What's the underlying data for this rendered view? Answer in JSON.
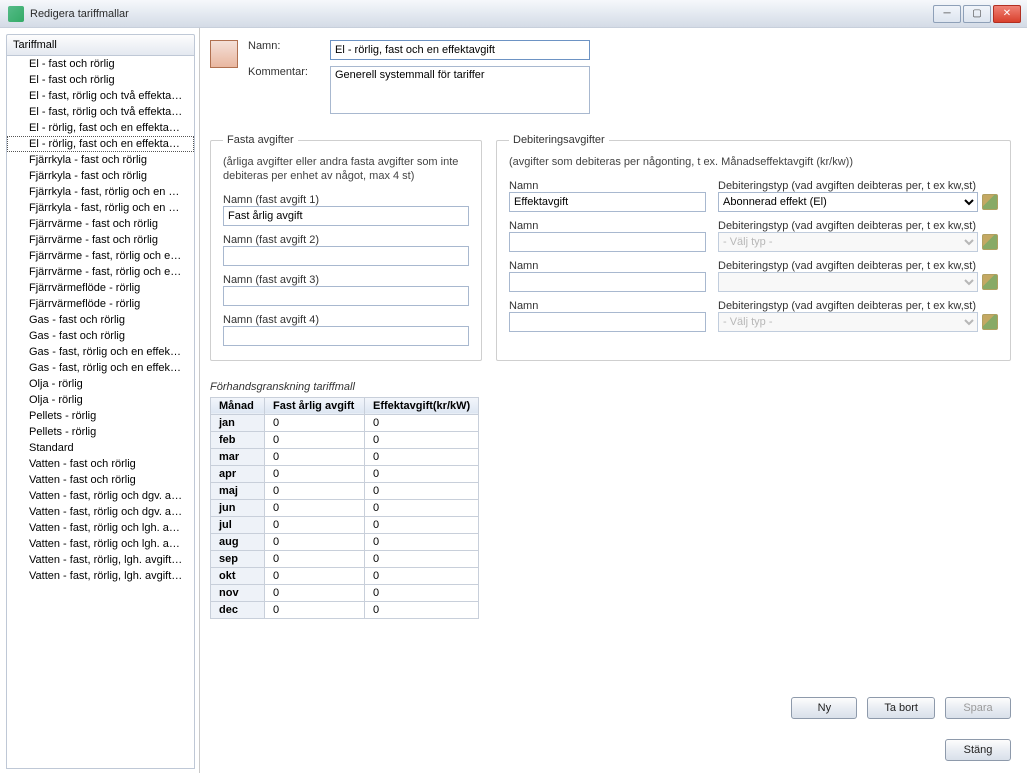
{
  "window": {
    "title": "Redigera tariffmallar"
  },
  "sidebar": {
    "header": "Tariffmall",
    "selected_index": 5,
    "items": [
      "El - fast och rörlig",
      "El - fast och rörlig",
      "El - fast, rörlig och två effektav...",
      "El - fast, rörlig och två effektav...",
      "El - rörlig, fast och en effektavgift",
      "El - rörlig, fast och en effektavgift",
      "Fjärrkyla - fast och rörlig",
      "Fjärrkyla - fast och rörlig",
      "Fjärrkyla - fast, rörlig och en kyl...",
      "Fjärrkyla - fast, rörlig och en kyl...",
      "Fjärrvärme - fast och rörlig",
      "Fjärrvärme - fast och rörlig",
      "Fjärrvärme - fast, rörlig och en ...",
      "Fjärrvärme - fast, rörlig och en ...",
      "Fjärrvärmeflöde - rörlig",
      "Fjärrvärmeflöde - rörlig",
      "Gas - fast och rörlig",
      "Gas - fast och rörlig",
      "Gas - fast, rörlig och en effekta...",
      "Gas - fast, rörlig och en effekta...",
      "Olja - rörlig",
      "Olja - rörlig",
      "Pellets - rörlig",
      "Pellets - rörlig",
      "Standard",
      "Vatten - fast och rörlig",
      "Vatten - fast och rörlig",
      "Vatten - fast, rörlig och dgv. av...",
      "Vatten - fast, rörlig och dgv. av...",
      "Vatten - fast, rörlig och lgh. avgift",
      "Vatten - fast, rörlig och lgh. avgift",
      "Vatten - fast, rörlig, lgh. avgift o...",
      "Vatten - fast, rörlig, lgh. avgift o..."
    ]
  },
  "labels": {
    "name": "Namn:",
    "comment": "Kommentar:"
  },
  "form": {
    "name_value": "El - rörlig, fast och en effektavgift",
    "comment_value": "Generell systemmall för tariffer"
  },
  "fixed": {
    "legend": "Fasta avgifter",
    "desc": "(årliga avgifter eller andra fasta avgifter som inte debiteras per enhet av något, max 4 st)",
    "f1": {
      "label": "Namn (fast avgift 1)",
      "value": "Fast årlig avgift"
    },
    "f2": {
      "label": "Namn (fast avgift 2)",
      "value": ""
    },
    "f3": {
      "label": "Namn (fast avgift 3)",
      "value": ""
    },
    "f4": {
      "label": "Namn (fast avgift 4)",
      "value": ""
    }
  },
  "debit": {
    "legend": "Debiteringsavgifter",
    "desc": "(avgifter som debiteras per någonting, t ex. Månadseffektavgift (kr/kw))",
    "name_label": "Namn",
    "type_label": "Debiteringstyp (vad avgiften deibteras per, t ex kw,st)",
    "placeholder_type": "- Välj typ -",
    "rows": [
      {
        "name": "Effektavgift",
        "type": "Abonnerad effekt (El)",
        "enabled": true
      },
      {
        "name": "",
        "type": "- Välj typ -",
        "enabled": false
      },
      {
        "name": "",
        "type": "",
        "enabled": false,
        "blank": true
      },
      {
        "name": "",
        "type": "- Välj typ -",
        "enabled": false
      }
    ]
  },
  "preview": {
    "title": "Förhandsgranskning tariffmall",
    "headers": [
      "Månad",
      "Fast årlig avgift",
      "Effektavgift(kr/kW)"
    ],
    "rows": [
      [
        "jan",
        "0",
        "0"
      ],
      [
        "feb",
        "0",
        "0"
      ],
      [
        "mar",
        "0",
        "0"
      ],
      [
        "apr",
        "0",
        "0"
      ],
      [
        "maj",
        "0",
        "0"
      ],
      [
        "jun",
        "0",
        "0"
      ],
      [
        "jul",
        "0",
        "0"
      ],
      [
        "aug",
        "0",
        "0"
      ],
      [
        "sep",
        "0",
        "0"
      ],
      [
        "okt",
        "0",
        "0"
      ],
      [
        "nov",
        "0",
        "0"
      ],
      [
        "dec",
        "0",
        "0"
      ]
    ]
  },
  "buttons": {
    "new": "Ny",
    "delete": "Ta bort",
    "save": "Spara",
    "close": "Stäng"
  }
}
